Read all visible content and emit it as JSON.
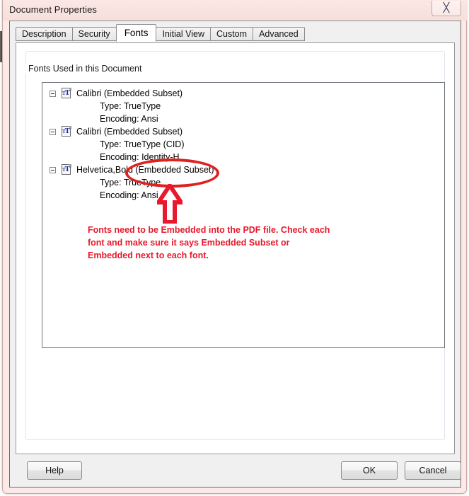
{
  "window": {
    "title": "Document Properties",
    "close_glyph": "✖",
    "close_label": "Close"
  },
  "tabs": [
    {
      "label": "Description",
      "active": false
    },
    {
      "label": "Security",
      "active": false
    },
    {
      "label": "Fonts",
      "active": true
    },
    {
      "label": "Initial View",
      "active": false
    },
    {
      "label": "Custom",
      "active": false
    },
    {
      "label": "Advanced",
      "active": false
    }
  ],
  "group": {
    "label": "Fonts Used in this Document"
  },
  "font_tree": [
    {
      "name": "Calibri (Embedded Subset)",
      "details": [
        "Type: TrueType",
        "Encoding: Ansi"
      ]
    },
    {
      "name": "Calibri (Embedded Subset)",
      "details": [
        "Type: TrueType (CID)",
        "Encoding: Identity-H"
      ]
    },
    {
      "name": "Helvetica,Bold (Embedded Subset)",
      "details": [
        "Type: TrueType",
        "Encoding: Ansi"
      ]
    }
  ],
  "annotations": {
    "note_text": "Fonts need to be Embedded into the PDF file. Check each font and make sure it says Embedded Subset or Embedded next to each font.",
    "note_color": "#e8192c",
    "ellipse_color": "#e02020",
    "arrow_color": "#e8192c",
    "ellipse_target": "(Embedded Subset)"
  },
  "buttons": {
    "help": "Help",
    "ok": "OK",
    "cancel": "Cancel"
  },
  "colors": {
    "frame": "#fae6e3",
    "dialog": "#f0f0f0",
    "tab_active": "#ffffff",
    "list_background": "#ffffff",
    "font_icon_letter": "#1c27a8"
  }
}
